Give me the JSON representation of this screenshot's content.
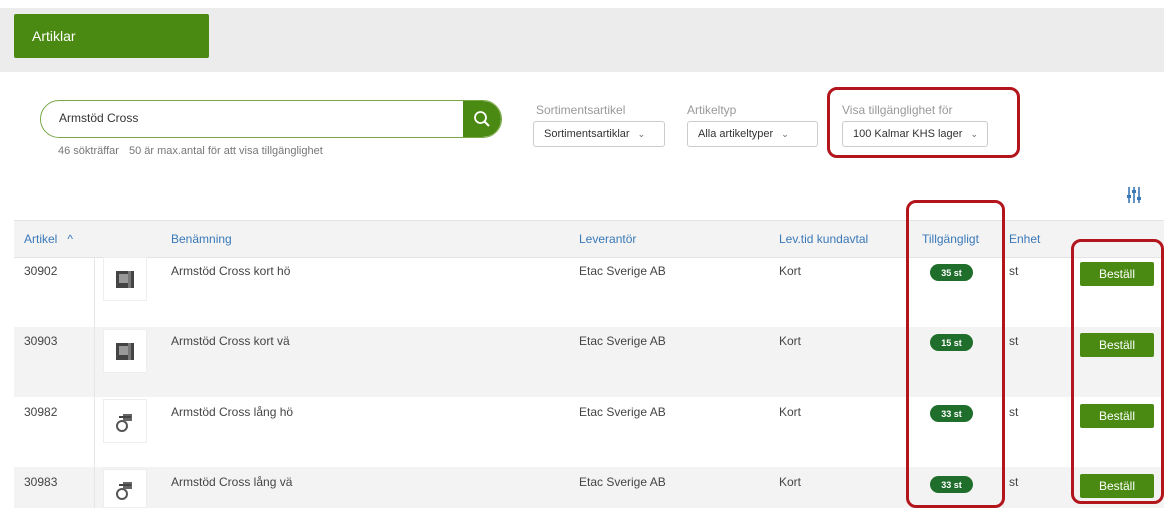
{
  "header": {
    "tab_label": "Artiklar"
  },
  "search": {
    "value": "Armstöd Cross",
    "hits_text": "46 sökträffar",
    "max_text": "50 är max.antal för att visa tillgänglighet"
  },
  "filters": {
    "sortiment": {
      "label": "Sortimentsartikel",
      "value": "Sortimentsartiklar"
    },
    "artikeltyp": {
      "label": "Artikeltyp",
      "value": "Alla artikeltyper"
    },
    "availability": {
      "label": "Visa tillgänglighet för",
      "value": "100 Kalmar KHS lager"
    }
  },
  "table": {
    "headers": {
      "artikel": "Artikel",
      "benamning": "Benämning",
      "leverantor": "Leverantör",
      "levtid": "Lev.tid kundavtal",
      "tillgangligt": "Tillgängligt",
      "enhet": "Enhet"
    },
    "rows": [
      {
        "artikel": "30902",
        "benamning": "Armstöd Cross kort hö",
        "leverantor": "Etac Sverige AB",
        "levtid": "Kort",
        "tillgangligt": "35 st",
        "enhet": "st",
        "action": "Beställ"
      },
      {
        "artikel": "30903",
        "benamning": "Armstöd Cross kort vä",
        "leverantor": "Etac Sverige AB",
        "levtid": "Kort",
        "tillgangligt": "15 st",
        "enhet": "st",
        "action": "Beställ"
      },
      {
        "artikel": "30982",
        "benamning": "Armstöd Cross lång hö",
        "leverantor": "Etac Sverige AB",
        "levtid": "Kort",
        "tillgangligt": "33 st",
        "enhet": "st",
        "action": "Beställ"
      },
      {
        "artikel": "30983",
        "benamning": "Armstöd Cross lång vä",
        "leverantor": "Etac Sverige AB",
        "levtid": "Kort",
        "tillgangligt": "33 st",
        "enhet": "st",
        "action": "Beställ"
      }
    ]
  },
  "icons": {
    "search": "search-icon",
    "sort": "sort-caret-up-icon",
    "chevron": "chevron-down-icon",
    "settings": "column-settings-icon"
  },
  "colors": {
    "primary_green": "#4a8a12",
    "badge_green": "#1f6e2b",
    "header_link": "#3a79b8",
    "highlight_red": "#b3151c"
  }
}
